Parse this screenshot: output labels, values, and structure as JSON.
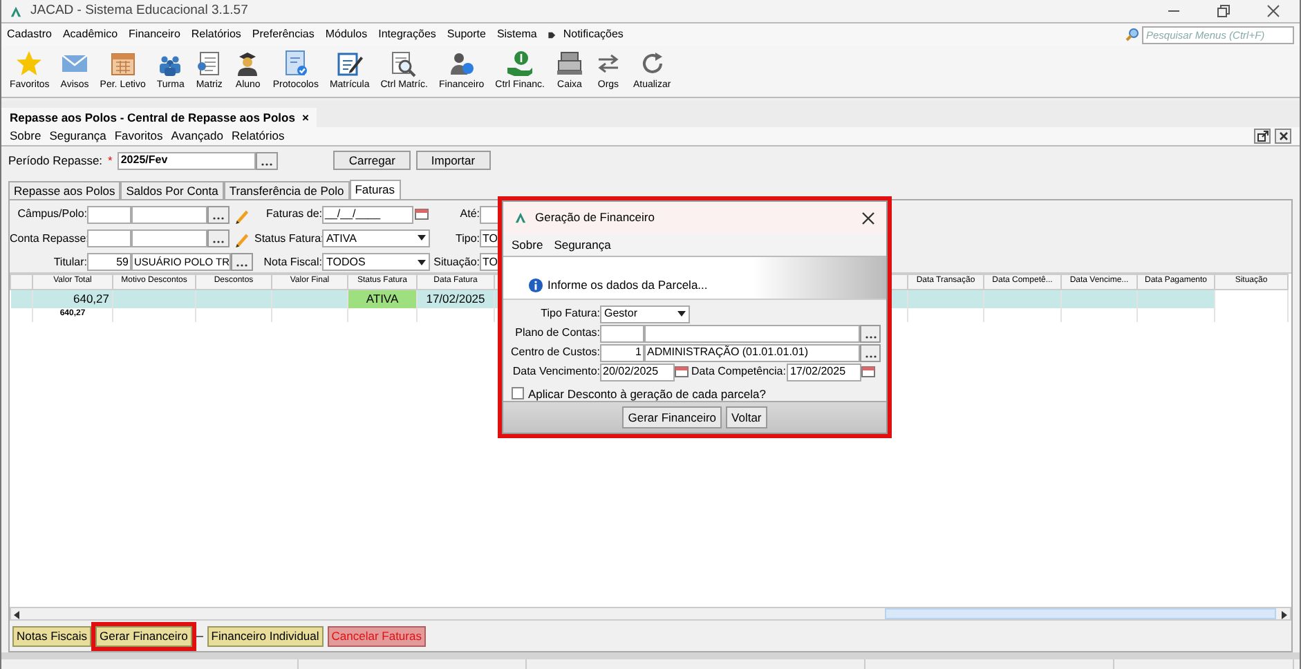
{
  "window": {
    "title": "JACAD - Sistema Educacional 3.1.57"
  },
  "menu": [
    "Cadastro",
    "Acadêmico",
    "Financeiro",
    "Relatórios",
    "Preferências",
    "Módulos",
    "Integrações",
    "Suporte",
    "Sistema"
  ],
  "notifications": {
    "label": "Notificações"
  },
  "menu_search": {
    "placeholder": "Pesquisar Menus (Ctrl+F)"
  },
  "toolbar": [
    {
      "label": "Favoritos"
    },
    {
      "label": "Avisos"
    },
    {
      "label": "Per. Letivo"
    },
    {
      "label": "Turma"
    },
    {
      "label": "Matriz"
    },
    {
      "label": "Aluno"
    },
    {
      "label": "Protocolos"
    },
    {
      "label": "Matrícula"
    },
    {
      "label": "Ctrl Matríc."
    },
    {
      "label": "Financeiro"
    },
    {
      "label": "Ctrl Financ."
    },
    {
      "label": "Caixa"
    },
    {
      "label": "Orgs"
    },
    {
      "label": "Atualizar"
    }
  ],
  "document_tab": {
    "title": "Repasse aos Polos - Central de Repasse aos Polos",
    "close": "×"
  },
  "submenu": [
    "Sobre",
    "Segurança",
    "Favoritos",
    "Avançado",
    "Relatórios"
  ],
  "period": {
    "label": "Período Repasse:",
    "required_mark": "*",
    "value": "2025/Fev"
  },
  "actions": [
    "Carregar",
    "Importar"
  ],
  "tabs": [
    {
      "label": "Repasse aos Polos",
      "selected": false
    },
    {
      "label": "Saldos Por Conta",
      "selected": false
    },
    {
      "label": "Transferência de Polo",
      "selected": false
    },
    {
      "label": "Faturas",
      "selected": true
    }
  ],
  "filters": {
    "campus": {
      "label": "Câmpus/Polo:"
    },
    "conta": {
      "label": "Conta Repasse:"
    },
    "titular": {
      "label": "Titular:",
      "code": "59",
      "name": "USUÁRIO POLO TR"
    },
    "faturas_de": {
      "label": "Faturas de:",
      "value": "__/__/____"
    },
    "status_fatura": {
      "label": "Status Fatura:",
      "value": "ATIVA"
    },
    "nota_fiscal": {
      "label": "Nota Fiscal:",
      "value": "TODOS"
    },
    "ate": {
      "label": "Até:"
    },
    "tipo": {
      "label": "Tipo:",
      "value": "TO"
    },
    "situacao": {
      "label": "Situação:",
      "value": "TO"
    }
  },
  "table": {
    "columns": [
      "Valor Total",
      "Motivo Descontos",
      "Descontos",
      "Valor Final",
      "Status Fatura",
      "Data Fatura",
      "Data Transação",
      "Data Competê...",
      "Data Vencime...",
      "Data Pagamento",
      "Situação"
    ],
    "rows": [
      {
        "selected": true,
        "valor_total": "640,27",
        "status_fatura": {
          "text": "ATIVA",
          "color": "#9ee07f"
        },
        "data_fatura": "17/02/2025"
      }
    ],
    "total": "640,27"
  },
  "bottom_buttons": [
    {
      "label": "Notas Fiscais",
      "kind": "normal",
      "highlighted": false
    },
    {
      "label": "Gerar Financeiro",
      "kind": "normal",
      "highlighted": true
    },
    {
      "label": "Financeiro Individual",
      "kind": "normal",
      "highlighted": false
    },
    {
      "label": "Cancelar Faturas",
      "kind": "danger",
      "highlighted": false
    }
  ],
  "dialog": {
    "title": "Geração de Financeiro",
    "highlighted": true,
    "menu": [
      "Sobre",
      "Segurança"
    ],
    "info": "Informe os dados da Parcela...",
    "tipo_fatura": {
      "label": "Tipo Fatura:",
      "value": "Gestor"
    },
    "plano_contas": {
      "label": "Plano de Contas:"
    },
    "centro_custos": {
      "label": "Centro de Custos:",
      "code": "1",
      "name": "ADMINISTRAÇÃO (01.01.01.01)"
    },
    "data_vencimento": {
      "label": "Data Vencimento:",
      "value": "20/02/2025"
    },
    "data_competencia": {
      "label": "Data Competência:",
      "value": "17/02/2025"
    },
    "apply_discount": {
      "label": "Aplicar Desconto à geração de cada parcela?",
      "checked": false
    },
    "buttons": [
      "Gerar Financeiro",
      "Voltar"
    ]
  }
}
